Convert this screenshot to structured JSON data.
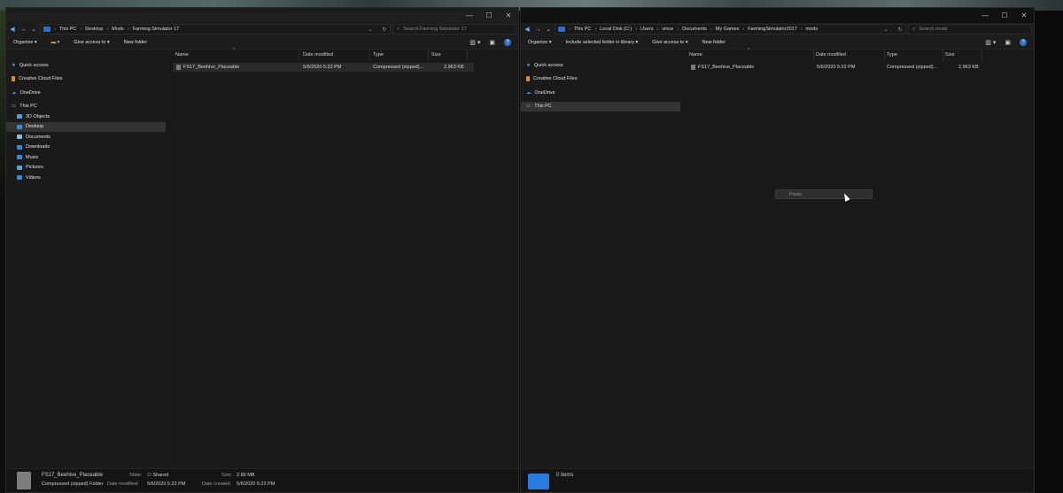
{
  "left_window": {
    "breadcrumb": [
      "This PC",
      "Desktop",
      "Mods",
      "Farming Simulator 17"
    ],
    "search_placeholder": "Search Farming Simulator 17",
    "toolbar": {
      "organize": "Organize ▾",
      "share": "Give access to ▾",
      "new_folder": "New folder"
    },
    "nav": {
      "quick_access": "Quick access",
      "creative_cloud": "Creative Cloud Files",
      "onedrive": "OneDrive",
      "this_pc": "This PC",
      "objects3d": "3D Objects",
      "desktop": "Desktop",
      "documents": "Documents",
      "downloads": "Downloads",
      "music": "Music",
      "pictures": "Pictures",
      "videos": "Videos"
    },
    "columns": {
      "name": "Name",
      "date": "Date modified",
      "type": "Type",
      "size": "Size"
    },
    "files": [
      {
        "name": "FS17_Beehive_Placeable",
        "date": "5/6/2020 5:22 PM",
        "type": "Compressed (zipped)...",
        "size": "2,963 KB"
      }
    ],
    "details": {
      "filename": "FS17_Beehive_Placeable",
      "filetype": "Compressed (zipped) Folder",
      "state_label": "State:",
      "state_value": "Shared",
      "date_modified_label": "Date modified:",
      "date_modified_value": "5/6/2020 5:22 PM",
      "size_label": "Size:",
      "size_value": "2.89 MB",
      "date_created_label": "Date created:",
      "date_created_value": "5/6/2020 5:22 PM"
    }
  },
  "right_window": {
    "breadcrumb": [
      "This PC",
      "Local Disk (C:)",
      "Users",
      "vince",
      "Documents",
      "My Games",
      "FarmingSimulator2017",
      "mods"
    ],
    "search_placeholder": "Search mods",
    "toolbar": {
      "organize": "Organize ▾",
      "include": "Include selected folder in library ▾",
      "share": "Give access to ▾",
      "new_folder": "New folder"
    },
    "nav": {
      "quick_access": "Quick access",
      "creative_cloud": "Creative Cloud Files",
      "onedrive": "OneDrive",
      "this_pc": "This PC"
    },
    "columns": {
      "name": "Name",
      "date": "Date modified",
      "type": "Type",
      "size": "Size"
    },
    "files": [
      {
        "name": "FS17_Beehive_Placeable",
        "date": "5/6/2020 5:22 PM",
        "type": "Compressed (zipped)...",
        "size": "2,963 KB"
      }
    ],
    "context_menu": {
      "paste": "Paste"
    },
    "status": {
      "items": "0 items"
    }
  },
  "colors": {
    "accent": "#2a6fc9",
    "selection": "#333333",
    "background": "#191919"
  },
  "icons": {
    "back": "arrow-left-icon",
    "forward": "arrow-right-icon",
    "folder": "folder-icon",
    "zip": "zip-file-icon",
    "search": "search-icon",
    "refresh": "refresh-icon",
    "help": "help-icon"
  }
}
